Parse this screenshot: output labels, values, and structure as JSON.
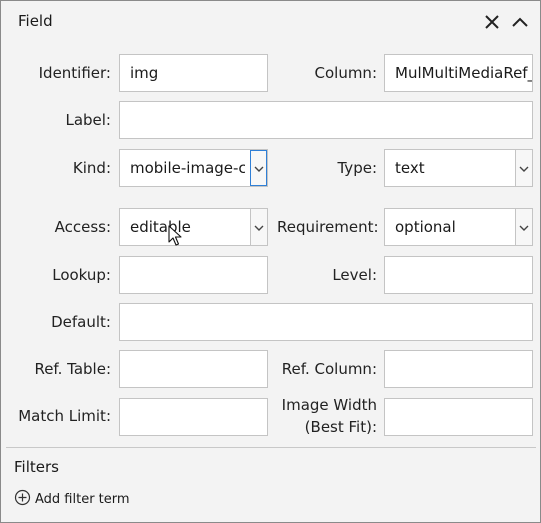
{
  "panel": {
    "title": "Field"
  },
  "fields": {
    "identifier": {
      "label": "Identifier:",
      "value": "img"
    },
    "column": {
      "label": "Column:",
      "value": "MulMultiMediaRef_"
    },
    "label": {
      "label": "Label:",
      "value": ""
    },
    "kind": {
      "label": "Kind:",
      "value": "mobile-image-ca"
    },
    "type": {
      "label": "Type:",
      "value": "text"
    },
    "access": {
      "label": "Access:",
      "value": "editable"
    },
    "requirement": {
      "label": "Requirement:",
      "value": "optional"
    },
    "lookup": {
      "label": "Lookup:",
      "value": ""
    },
    "level": {
      "label": "Level:",
      "value": ""
    },
    "default": {
      "label": "Default:",
      "value": ""
    },
    "ref_table": {
      "label": "Ref. Table:",
      "value": ""
    },
    "ref_column": {
      "label": "Ref. Column:",
      "value": ""
    },
    "match_limit": {
      "label": "Match Limit:",
      "value": ""
    },
    "image_width": {
      "label_line1": "Image Width",
      "label_line2": "(Best Fit):",
      "value": ""
    }
  },
  "filters": {
    "title": "Filters",
    "add_label": "Add filter term"
  },
  "icons": {
    "close": "close-icon",
    "collapse": "chevron-up-icon",
    "dropdown": "chevron-down-icon",
    "add": "plus-circle-icon",
    "cursor": "mouse-pointer-icon"
  },
  "colors": {
    "focus": "#2f7fd6",
    "border": "#c4c4c4",
    "background": "#f3f3f3"
  }
}
